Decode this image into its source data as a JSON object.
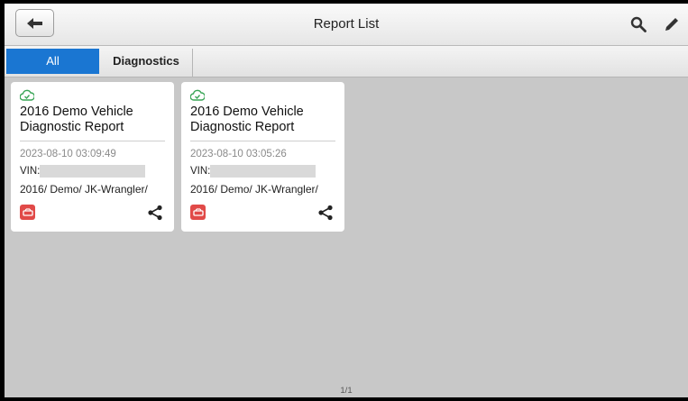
{
  "header": {
    "title": "Report List",
    "back_icon": "back-arrow-icon",
    "search_icon": "search-icon",
    "edit_icon": "pencil-icon"
  },
  "tabs": [
    {
      "label": "All",
      "selected": true
    },
    {
      "label": "Diagnostics",
      "selected": false
    }
  ],
  "reports": [
    {
      "status_icon": "cloud-check-icon",
      "title": "2016 Demo Vehicle Diagnostic Report",
      "date": "2023-08-10 03:09:49",
      "vin_label": "VIN:",
      "path": "2016/ Demo/ JK-Wrangler/",
      "vehicle_icon": "car-icon",
      "share_icon": "share-icon"
    },
    {
      "status_icon": "cloud-check-icon",
      "title": "2016 Demo Vehicle Diagnostic Report",
      "date": "2023-08-10 03:05:26",
      "vin_label": "VIN:",
      "path": "2016/ Demo/ JK-Wrangler/",
      "vehicle_icon": "car-icon",
      "share_icon": "share-icon"
    }
  ],
  "pager": "1/1",
  "colors": {
    "accent": "#1a76d2",
    "status_green": "#3aa657",
    "vehicle_red": "#e14a48"
  }
}
